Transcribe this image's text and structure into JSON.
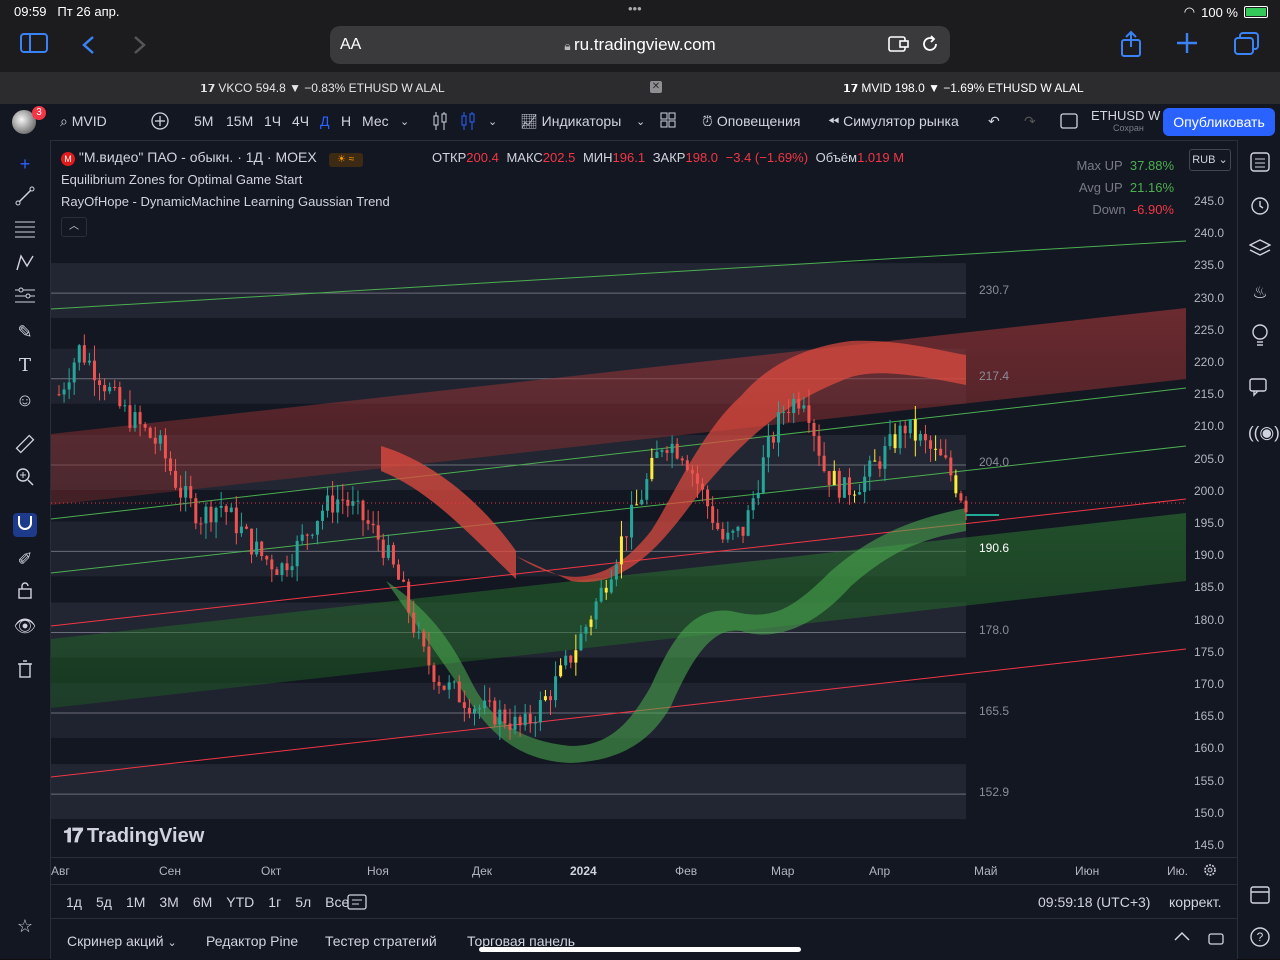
{
  "status": {
    "time": "09:59",
    "date": "Пт 26 апр.",
    "dots": "•••",
    "battery": "100 %"
  },
  "safari": {
    "aa": "AA",
    "url": "ru.tradingview.com"
  },
  "tabs": [
    {
      "text": "VKCO 594.8 ▼ −0.83% ETHUSD W ALAL"
    },
    {
      "text": "MVID 198.0 ▼ −1.69% ETHUSD W ALAL"
    }
  ],
  "toolbar": {
    "badge": "3",
    "symbol": "MVID",
    "intervals": [
      "5М",
      "15М",
      "1Ч",
      "4Ч",
      "Д",
      "Н",
      "Мес"
    ],
    "active_interval": "Д",
    "indicators": "Индикаторы",
    "alerts": "Оповещения",
    "replay": "Симулятор рынка",
    "layout_name": "ETHUSD W",
    "layout_sub": "Сохран",
    "publish": "Опубликовать"
  },
  "legend": {
    "title": "\"М.видео\" ПАО - обыкн. · 1Д · MOEX",
    "open_label": "ОТКР",
    "open": "200.4",
    "high_label": "МАКС",
    "high": "202.5",
    "low_label": "МИН",
    "low": "196.1",
    "close_label": "ЗАКР",
    "close": "198.0",
    "change": "−3.4 (−1.69%)",
    "volume_label": "Объём",
    "volume": "1.019 M",
    "indicator1": "Equilibrium Zones for Optimal Game Start",
    "indicator2": "RayOfHope - DynamicMachine Learning Gaussian Trend"
  },
  "stats": [
    {
      "label": "Max UP",
      "value": "37.88%",
      "color": "#4caf50"
    },
    {
      "label": "Avg UP",
      "value": "21.16%",
      "color": "#4caf50"
    },
    {
      "label": "Down",
      "value": "-6.90%",
      "color": "#f23645"
    }
  ],
  "currency": "RUB",
  "price_ticks": [
    "245.0",
    "240.0",
    "235.0",
    "230.0",
    "225.0",
    "220.0",
    "215.0",
    "210.0",
    "205.0",
    "200.0",
    "195.0",
    "190.0",
    "185.0",
    "180.0",
    "175.0",
    "170.0",
    "165.0",
    "160.0",
    "155.0",
    "150.0",
    "145.0"
  ],
  "zone_levels": [
    "230.7",
    "217.4",
    "204.0",
    "190.6",
    "178.0",
    "165.5",
    "152.9"
  ],
  "time_ticks": [
    "Авг",
    "Сен",
    "Окт",
    "Ноя",
    "Дек",
    "2024",
    "Фев",
    "Мар",
    "Апр",
    "Май",
    "Июн",
    "Ию."
  ],
  "watermark": "TradingView",
  "ranges": [
    "1д",
    "5д",
    "1М",
    "3М",
    "6М",
    "YTD",
    "1г",
    "5л",
    "Все"
  ],
  "clock": "09:59:18 (UTC+3)",
  "adjust": "коррект.",
  "bottom_tabs": [
    "Скринер акций",
    "Редактор Pine",
    "Тестер стратегий",
    "Торговая панель"
  ],
  "chart_data": {
    "type": "candlestick",
    "symbol": "MVID",
    "ylim": [
      145,
      245
    ],
    "last_price": 198.0,
    "zone_levels": [
      230.7,
      217.4,
      204.0,
      190.6,
      178.0,
      165.5,
      152.9
    ],
    "series": [
      {
        "name": "MVID",
        "values": [
          215,
          222,
          218,
          213,
          210,
          207,
          200,
          196,
          198,
          194,
          190,
          188,
          192,
          197,
          199,
          196,
          192,
          185,
          175,
          170,
          168,
          166,
          165,
          163,
          167,
          172,
          178,
          185,
          193,
          200,
          208,
          206,
          199,
          192,
          194,
          205,
          213,
          215,
          203,
          200,
          202,
          206,
          210,
          207,
          204,
          198
        ]
      }
    ]
  }
}
